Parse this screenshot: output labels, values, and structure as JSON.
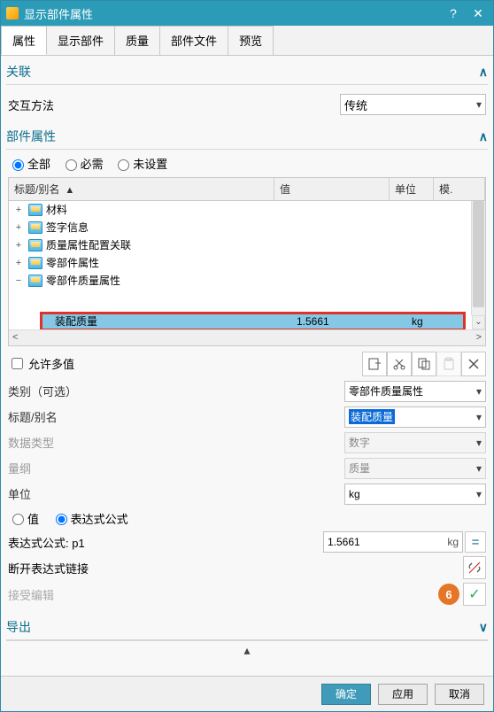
{
  "window": {
    "title": "显示部件属性"
  },
  "tabs": [
    "属性",
    "显示部件",
    "质量",
    "部件文件",
    "预览"
  ],
  "sections": {
    "assoc": {
      "title": "关联",
      "interaction_label": "交互方法",
      "interaction_value": "传统"
    },
    "attrs": {
      "title": "部件属性",
      "radios": [
        "全部",
        "必需",
        "未设置"
      ],
      "columns": {
        "title": "标题/别名",
        "value": "值",
        "unit": "单位",
        "mod": "模."
      },
      "tree": [
        {
          "exp": "+",
          "label": "材料"
        },
        {
          "exp": "+",
          "label": "签字信息"
        },
        {
          "exp": "+",
          "label": "质量属性配置关联"
        },
        {
          "exp": "+",
          "label": "零部件属性"
        },
        {
          "exp": "−",
          "label": "零部件质量属性"
        }
      ],
      "highlight": {
        "title": "装配质量",
        "value": "1.5661",
        "unit": "kg"
      },
      "allow_multi": "允许多值",
      "category_label": "类别（可选）",
      "category_value": "零部件质量属性",
      "title_label": "标题/别名",
      "title_value": "装配质量",
      "datatype_label": "数据类型",
      "datatype_value": "数字",
      "dimension_label": "量纲",
      "dimension_value": "质量",
      "unit_label": "单位",
      "unit_value": "kg",
      "value_or_expr": {
        "value_label": "值",
        "expr_label": "表达式公式"
      },
      "expr_label_full": "表达式公式: p1",
      "expr_value": "1.5661",
      "expr_unit": "kg",
      "break_link": "断开表达式链接",
      "accept_edit": "接受编辑",
      "step_badge": "6"
    },
    "export": {
      "title": "导出"
    }
  },
  "footer": {
    "ok": "确定",
    "apply": "应用",
    "cancel": "取消"
  }
}
